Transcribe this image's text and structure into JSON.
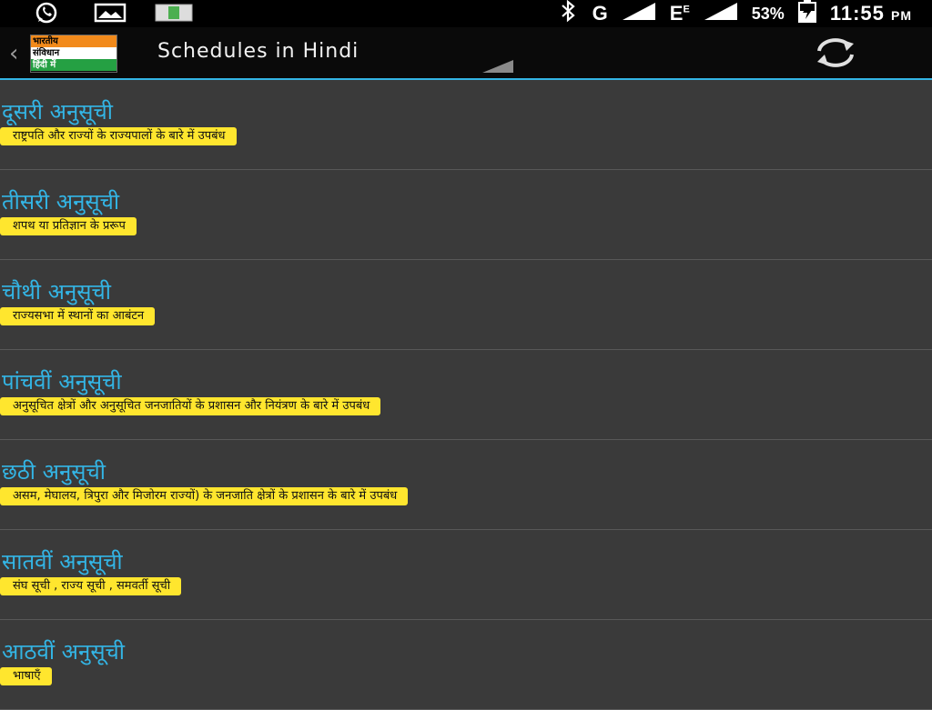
{
  "status_bar": {
    "icons": [
      "whatsapp-icon",
      "image-icon",
      "app-notification-icon"
    ],
    "network_g": "G",
    "network_e": "E",
    "network_e_super": "E",
    "battery_percent": "53%",
    "time": "11:55",
    "ampm": "PM"
  },
  "action_bar": {
    "logo_lines": [
      "भारतीय",
      "संविधान",
      "हिंदी में"
    ],
    "title": "Schedules in Hindi"
  },
  "schedules": [
    {
      "title": "दूसरी अनुसूची",
      "desc": "राष्ट्रपति और राज्यों के राज्यपालों के बारे में उपबंध"
    },
    {
      "title": "तीसरी अनुसूची",
      "desc": "शपथ या प्रतिज्ञान के प्ररूप"
    },
    {
      "title": "चौथी अनुसूची",
      "desc": "राज्यसभा में स्थानों का आबंटन"
    },
    {
      "title": "पांचवीं अनुसूची",
      "desc": "अनुसूचित क्षेत्रों और अनुसूचित जनजातियों के प्रशासन और नियंत्रण के बारे में उपबंध"
    },
    {
      "title": "छठी अनुसूची",
      "desc": "असम, मेघालय, त्रिपुरा और मिजोरम राज्यों) के जनजाति क्षेत्रों के प्रशासन के बारे में उपबंध"
    },
    {
      "title": "सातवीं अनुसूची",
      "desc": "संघ सूची , राज्य सूची , समवर्ती सूची"
    },
    {
      "title": "आठवीं अनुसूची",
      "desc": "भाषाएँ"
    }
  ],
  "colors": {
    "accent": "#33b5e5",
    "desc_bg": "#ffe62e",
    "list_bg": "#3a3a3a"
  }
}
